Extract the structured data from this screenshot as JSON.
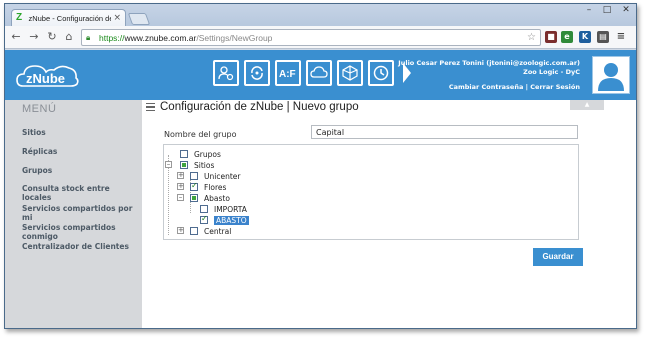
{
  "browser": {
    "tab_title": "zNube - Configuración de Gr",
    "url_scheme": "https://",
    "url_host": "www.znube.com.ar",
    "url_path": "/Settings/NewGroup"
  },
  "header": {
    "logo_text": "zNube",
    "user_name": "Julio Cesar Perez Tonini (jtonini@zoologic.com.ar)",
    "company": "Zoo Logic - DyC",
    "change_password": "Cambiar Contraseña",
    "separator": "|",
    "logout": "Cerrar Sesión",
    "module_icons": [
      "user-settings-icon",
      "sync-icon",
      "ab-config-icon",
      "cloud-icon",
      "cube-icon",
      "clock-icon"
    ]
  },
  "sidebar": {
    "title": "MENÚ",
    "items": [
      {
        "label": "Sitios"
      },
      {
        "label": "Réplicas"
      },
      {
        "label": "Grupos"
      },
      {
        "label": "Consulta stock entre locales"
      },
      {
        "label": "Servicios compartidos por mi"
      },
      {
        "label": "Servicios compartidos conmigo"
      },
      {
        "label": "Centralizador de Clientes"
      }
    ]
  },
  "main": {
    "heading": "Configuración de zNube | Nuevo grupo",
    "collapse_icon": "chevron-up-icon",
    "group_name_label": "Nombre del grupo",
    "group_name_value": "Capital",
    "tree": {
      "grupos": "Grupos",
      "sitios": "Sitios",
      "unicenter": "Unicenter",
      "flores": "Flores",
      "abasto": "Abasto",
      "importa": "IMPORTA",
      "abasto_child": "ABASTO",
      "central": "Central"
    },
    "save_label": "Guardar"
  },
  "colors": {
    "brand": "#3a8fd0",
    "sidebar_bg": "#d6d8db",
    "selected_bg": "#3b83cc"
  }
}
